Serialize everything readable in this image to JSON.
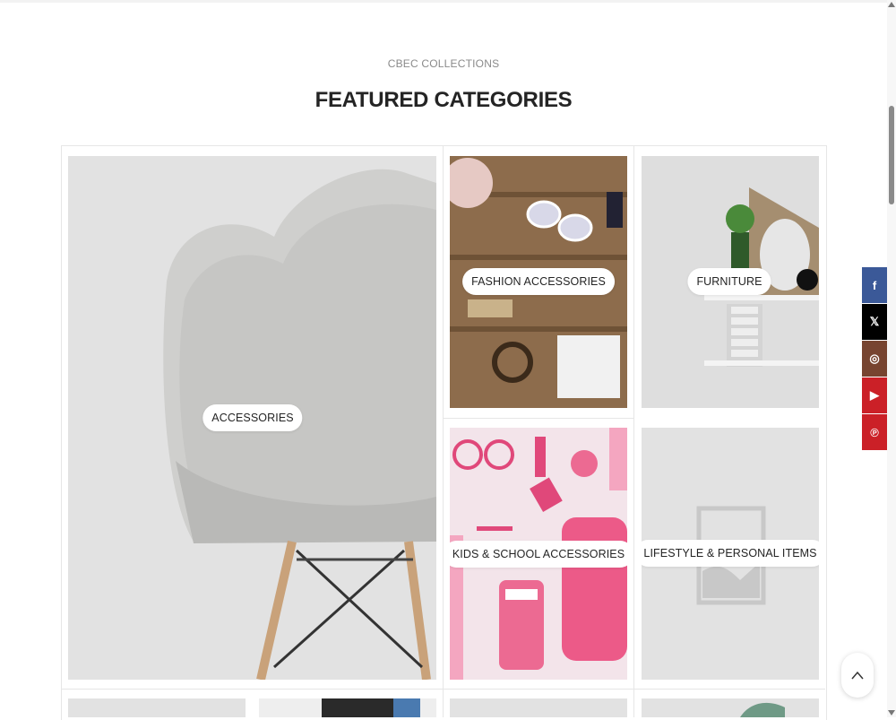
{
  "section": {
    "eyebrow": "CBEC COLLECTIONS",
    "title": "FEATURED CATEGORIES"
  },
  "categories": [
    {
      "label": "ACCESSORIES"
    },
    {
      "label": "FASHION ACCESSORIES"
    },
    {
      "label": "FURNITURE"
    },
    {
      "label": "KIDS & SCHOOL ACCESSORIES"
    },
    {
      "label": "LIFESTYLE & PERSONAL ITEMS"
    }
  ],
  "social": [
    {
      "icon": "facebook-icon",
      "glyph": "f",
      "color": "#3b5998"
    },
    {
      "icon": "x-icon",
      "glyph": "𝕏",
      "color": "#000000"
    },
    {
      "icon": "instagram-icon",
      "glyph": "◎",
      "color": "#774430"
    },
    {
      "icon": "youtube-icon",
      "glyph": "▶",
      "color": "#cb2027"
    },
    {
      "icon": "pinterest-icon",
      "glyph": "℗",
      "color": "#cb2027"
    }
  ],
  "scroll_to_top": {
    "icon": "chevron-up-icon"
  }
}
